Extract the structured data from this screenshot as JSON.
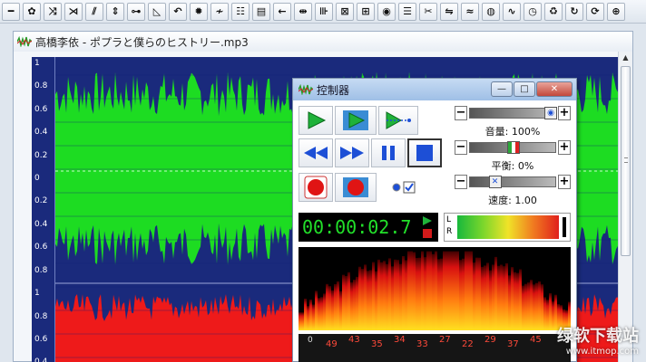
{
  "toolbar": {
    "buttons": [
      {
        "name": "line-tool",
        "glyph": "━"
      },
      {
        "name": "waveform-select-tool",
        "glyph": "✿"
      },
      {
        "name": "crossfade-tool",
        "glyph": "⤨"
      },
      {
        "name": "trim-tool",
        "glyph": "⋊"
      },
      {
        "name": "split-tool",
        "glyph": "⫽"
      },
      {
        "name": "expand-tool",
        "glyph": "⇕"
      },
      {
        "name": "normalize-tool",
        "glyph": "⊶"
      },
      {
        "name": "fade-tool",
        "glyph": "◺"
      },
      {
        "name": "undo-tool",
        "glyph": "↶"
      },
      {
        "name": "effects-tool",
        "glyph": "✹"
      },
      {
        "name": "noise-tool",
        "glyph": "≁"
      },
      {
        "name": "table-tool",
        "glyph": "☷"
      },
      {
        "name": "spectrum-tool",
        "glyph": "▤"
      },
      {
        "name": "back-tool",
        "glyph": "←"
      },
      {
        "name": "center-tool",
        "glyph": "⇹"
      },
      {
        "name": "eq-tool",
        "glyph": "⊪"
      },
      {
        "name": "filter-tool",
        "glyph": "⊠"
      },
      {
        "name": "mix-tool",
        "glyph": "⊞"
      },
      {
        "name": "eye-tool",
        "glyph": "◉"
      },
      {
        "name": "bars-tool",
        "glyph": "☰"
      },
      {
        "name": "scissor-tool",
        "glyph": "✂"
      },
      {
        "name": "reverse-tool",
        "glyph": "⇋"
      },
      {
        "name": "pitch-tool",
        "glyph": "≈"
      },
      {
        "name": "color-tool",
        "glyph": "◍"
      },
      {
        "name": "wave2-tool",
        "glyph": "∿"
      },
      {
        "name": "tempo-tool",
        "glyph": "◷"
      },
      {
        "name": "too-tool",
        "glyph": "♻"
      },
      {
        "name": "cycle-tool",
        "glyph": "↻"
      },
      {
        "name": "speed-tool",
        "glyph": "⟳"
      },
      {
        "name": "more-tool",
        "glyph": "⊕"
      }
    ]
  },
  "document": {
    "title": "高橋李依 - ポプラと僕らのヒストリー.mp3"
  },
  "waveform": {
    "ruler_labels": [
      "1",
      "0.8",
      "0.6",
      "0.4",
      "0.2",
      "0",
      "0.2",
      "0.4",
      "0.6",
      "0.8",
      "1",
      "0.8",
      "0.6",
      "0.4"
    ],
    "channel1_color": "#1ddc22",
    "channel2_color": "#ee1a1a",
    "background_color": "#1a2a7c"
  },
  "controller": {
    "title": "控制器",
    "minimize": "—",
    "maximize": "□",
    "close": "✕",
    "volume_label": "音量: 100%",
    "volume_level": 1.0,
    "balance_label": "平衡: 0%",
    "balance_level": 0.5,
    "speed_label": "速度: 1.00",
    "speed_level": 0.25,
    "minus": "−",
    "plus": "+",
    "time": "00:00:02.7",
    "meter_left": "L",
    "meter_right": "R",
    "eq_zero": "0",
    "eq_values": [
      "49",
      "43",
      "35",
      "34",
      "33",
      "27",
      "22",
      "29",
      "37",
      "45"
    ]
  },
  "watermark": {
    "main": "绿软下载站",
    "sub": "www.itmop.com"
  }
}
